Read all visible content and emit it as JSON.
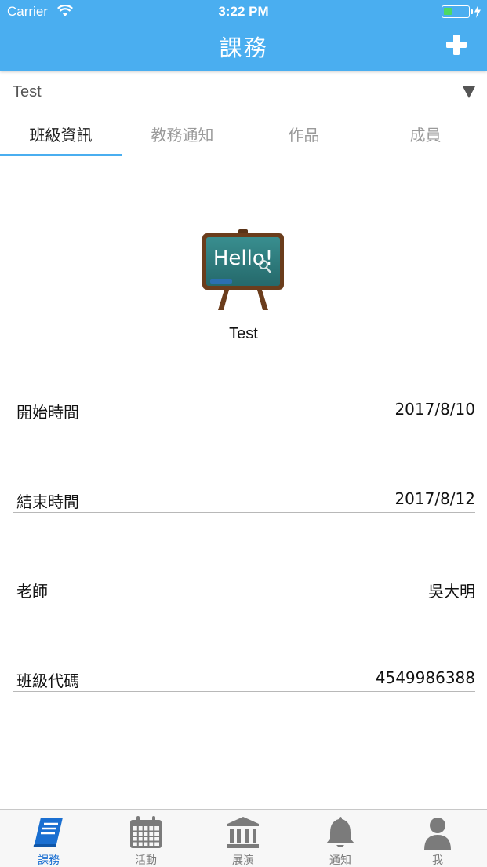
{
  "status_bar": {
    "carrier": "Carrier",
    "time": "3:22 PM",
    "battery_level": 0.35
  },
  "header": {
    "title": "課務",
    "add_icon": "plus-icon"
  },
  "class_selector": {
    "value": "Test",
    "icon": "triangle-down-icon"
  },
  "tabs": [
    {
      "label": "班級資訊",
      "active": true
    },
    {
      "label": "教務通知",
      "active": false
    },
    {
      "label": "作品",
      "active": false
    },
    {
      "label": "成員",
      "active": false
    }
  ],
  "class_info": {
    "icon": "chalkboard-icon",
    "icon_text": "Hello!",
    "name": "Test",
    "rows": [
      {
        "label": "開始時間",
        "value": "2017/8/10"
      },
      {
        "label": "結束時間",
        "value": "2017/8/12"
      },
      {
        "label": "老師",
        "value": "吳大明"
      },
      {
        "label": "班級代碼",
        "value": "4549986388"
      }
    ]
  },
  "tabbar": [
    {
      "label": "課務",
      "icon": "book-icon",
      "active": true
    },
    {
      "label": "活動",
      "icon": "calendar-icon",
      "active": false
    },
    {
      "label": "展演",
      "icon": "museum-icon",
      "active": false
    },
    {
      "label": "通知",
      "icon": "bell-icon",
      "active": false
    },
    {
      "label": "我",
      "icon": "person-icon",
      "active": false
    }
  ],
  "colors": {
    "header": "#4aaef0",
    "tab_indicator": "#4aaef0",
    "tabbar_active": "#1a6fd1",
    "tabbar_inactive": "#7b7b7b",
    "battery": "#4cd964"
  }
}
